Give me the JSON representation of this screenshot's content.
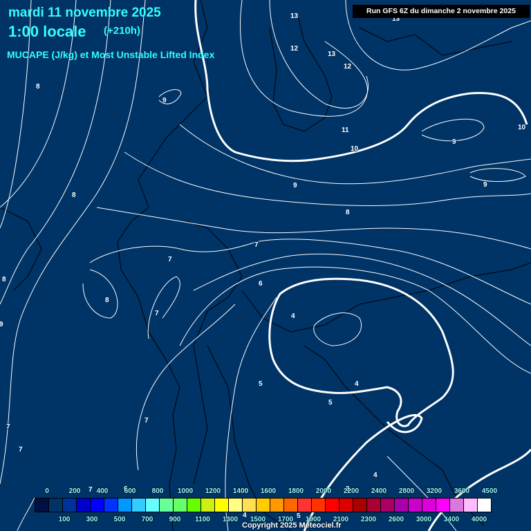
{
  "header": {
    "date": "mardi 11 novembre 2025",
    "time": "1:00 locale",
    "lead": "(+210h)",
    "parameter": "MUCAPE (J/kg) et Most Unstable Lifted Index",
    "run": "Run GFS 6Z du dimanche 2 novembre 2025"
  },
  "colors": {
    "background": "#003366",
    "contour": "#ffffff",
    "title": "#33ffff"
  },
  "colorbar": {
    "colors": [
      "#001040",
      "#003366",
      "#003399",
      "#0000cc",
      "#0000ff",
      "#0033ff",
      "#0099ff",
      "#33ccff",
      "#66ffff",
      "#66ff99",
      "#66ff66",
      "#66ff00",
      "#ccf010",
      "#ffff00",
      "#ffff80",
      "#ffe050",
      "#ffcc00",
      "#ff9900",
      "#ff6600",
      "#ff3333",
      "#ff3300",
      "#ff0000",
      "#dd0000",
      "#aa0000",
      "#aa0033",
      "#aa0066",
      "#aa00aa",
      "#cc00cc",
      "#dd00dd",
      "#ff00ff",
      "#dd77dd",
      "#ffbbff",
      "#ffffff"
    ],
    "top_labels": [
      "0",
      "200",
      "400",
      "600",
      "800",
      "1000",
      "1200",
      "1400",
      "1600",
      "1800",
      "2000",
      "2200",
      "2400",
      "2800",
      "3200",
      "3600",
      "4500"
    ],
    "bottom_labels": [
      "100",
      "300",
      "500",
      "700",
      "900",
      "1100",
      "1300",
      "1500",
      "1700",
      "1900",
      "2100",
      "2300",
      "2600",
      "3000",
      "3400",
      "4000"
    ]
  },
  "contour_labels": [
    "13",
    "13",
    "12",
    "13",
    "12",
    "8",
    "9",
    "11",
    "10",
    "10",
    "9",
    "9",
    "9",
    "8",
    "8",
    "7",
    "7",
    "8",
    "6",
    "8",
    "7",
    "4",
    "9",
    "5",
    "4",
    "5",
    "7",
    "7",
    "7",
    "4",
    "7",
    "6",
    "3",
    "4",
    "5"
  ],
  "copyright": "Copyright 2025 Meteociel.fr"
}
